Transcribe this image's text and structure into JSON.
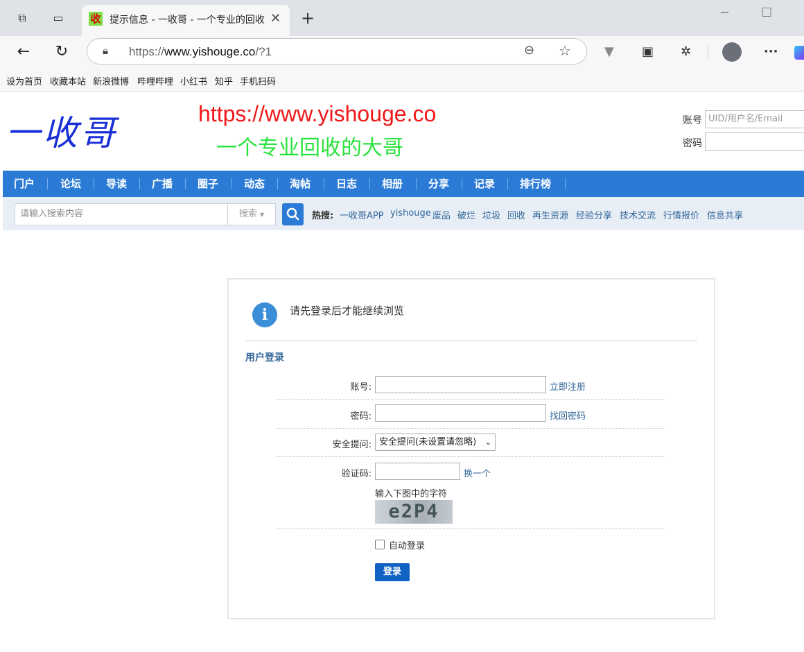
{
  "browser": {
    "tab_favicon": "收",
    "tab_title": "提示信息 - 一收哥 - 一个专业的回收的大哥",
    "url_prefix": "https://",
    "url_host": "www.yishouge.co",
    "url_path": "/?1"
  },
  "favorites": [
    "设为首页",
    "收藏本站",
    "新浪微博",
    "哔哩哔哩",
    "小红书",
    "知乎",
    "手机扫码"
  ],
  "header": {
    "logo_text": "一收哥",
    "site_url": "https://www.yishouge.co",
    "slogan": "一个专业回收的大哥",
    "account_label": "账号",
    "account_placeholder": "UID/用户名/Email",
    "password_label": "密码"
  },
  "nav": [
    "门户",
    "论坛",
    "导读",
    "广播",
    "圈子",
    "动态",
    "淘帖",
    "日志",
    "相册",
    "分享",
    "记录",
    "排行榜"
  ],
  "search": {
    "placeholder": "请输入搜索内容",
    "type": "搜索",
    "hot_label": "热搜:",
    "hot": [
      "一收哥APP",
      "yishouge",
      "废品",
      "破烂",
      "垃圾",
      "回收",
      "再生资源",
      "经验分享",
      "技术交流",
      "行情报价",
      "信息共享"
    ]
  },
  "login": {
    "message": "请先登录后才能继续浏览",
    "title": "用户登录",
    "account_label": "账号:",
    "register_link": "立即注册",
    "password_label": "密码:",
    "forgot_link": "找回密码",
    "question_label": "安全提问:",
    "question_value": "安全提问(未设置请忽略)",
    "captcha_label": "验证码:",
    "captcha_refresh": "换一个",
    "captcha_hint": "输入下图中的字符",
    "captcha_text": "e2P4",
    "autologin_label": "自动登录",
    "submit": "登录"
  },
  "colors": {
    "nav_bg": "#2b7bd6",
    "link": "#336699",
    "button": "#1262c4"
  }
}
